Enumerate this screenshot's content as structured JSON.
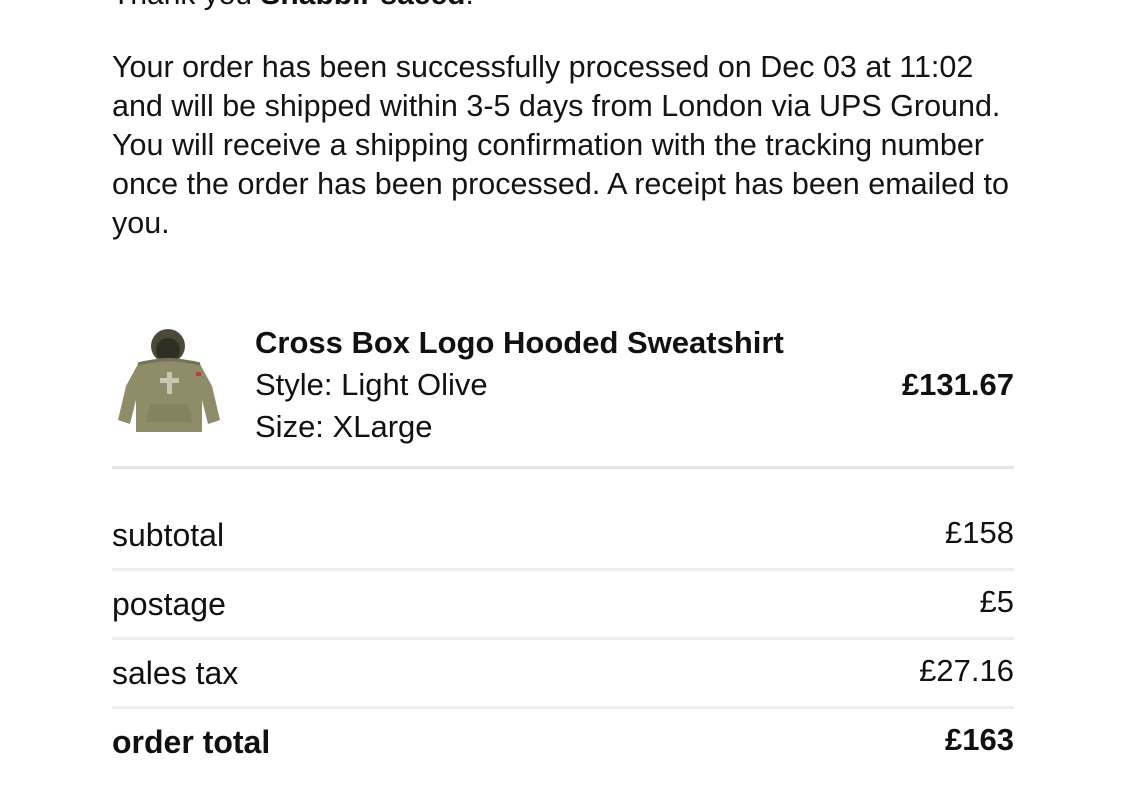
{
  "greeting": {
    "prefix": "Thank you ",
    "name": "Shabbir saeed",
    "suffix": "."
  },
  "message": "Your order has been successfully processed on Dec 03 at 11:02 and will be shipped within 3-5 days from London via UPS Ground. You will receive a shipping confirmation with the tracking number once the order has been processed. A receipt has been emailed to you.",
  "item": {
    "name": "Cross Box Logo Hooded Sweatshirt",
    "style": "Style: Light Olive",
    "size": "Size: XLarge",
    "price": "£131.67",
    "image_icon": "hooded-sweatshirt-image",
    "image_color": "#8f8c6a"
  },
  "totals": [
    {
      "label": "subtotal",
      "value": "£158"
    },
    {
      "label": "postage",
      "value": "£5"
    },
    {
      "label": "sales tax",
      "value": "£27.16"
    },
    {
      "label": "order total",
      "value": "£163"
    }
  ]
}
